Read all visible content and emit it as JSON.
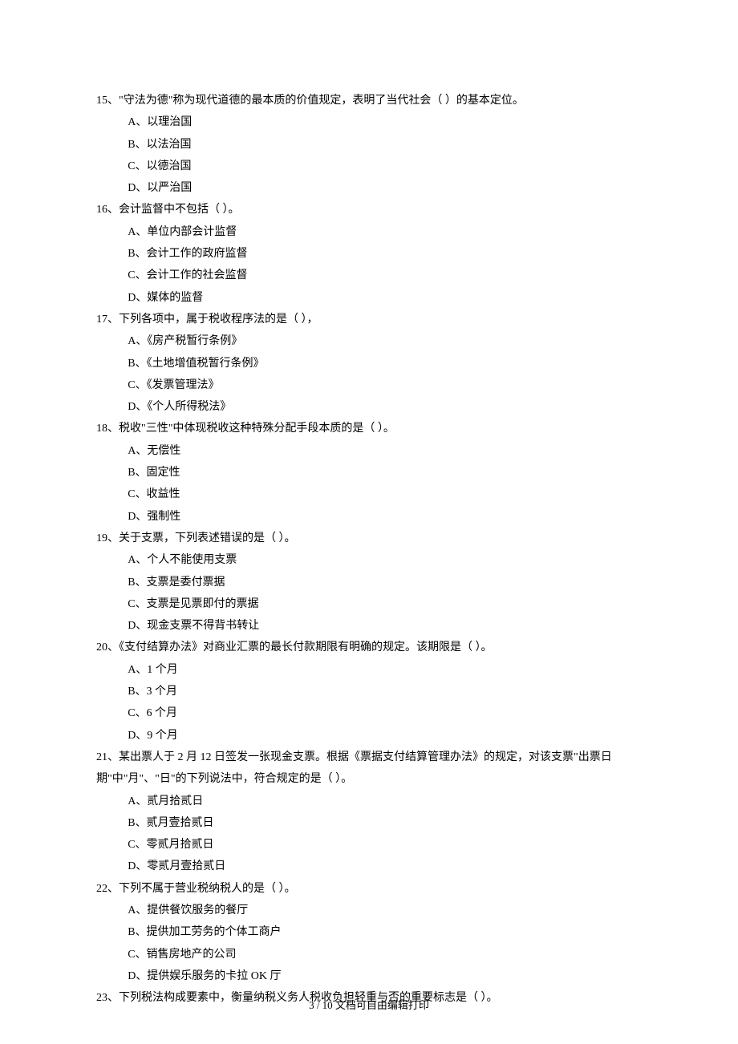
{
  "questions": [
    {
      "num": "15",
      "text": "、\"守法为德\"称为现代道德的最本质的价值规定，表明了当代社会（ ）的基本定位。",
      "options": [
        "A、以理治国",
        "B、以法治国",
        "C、以德治国",
        "D、以严治国"
      ]
    },
    {
      "num": "16",
      "text": "、会计监督中不包括（ ）。",
      "options": [
        "A、单位内部会计监督",
        "B、会计工作的政府监督",
        "C、会计工作的社会监督",
        "D、媒体的监督"
      ]
    },
    {
      "num": "17",
      "text": "、下列各项中，属于税收程序法的是（ ），",
      "options": [
        "A、《房产税暂行条例》",
        "B、《土地增值税暂行条例》",
        "C、《发票管理法》",
        "D、《个人所得税法》"
      ]
    },
    {
      "num": "18",
      "text": "、税收\"三性\"中体现税收这种特殊分配手段本质的是（ ）。",
      "options": [
        "A、无偿性",
        "B、固定性",
        "C、收益性",
        "D、强制性"
      ]
    },
    {
      "num": "19",
      "text": "、关于支票，下列表述错误的是（ ）。",
      "options": [
        "A、个人不能使用支票",
        "B、支票是委付票据",
        "C、支票是见票即付的票据",
        "D、现金支票不得背书转让"
      ]
    },
    {
      "num": "20",
      "text": "、《支付结算办法》对商业汇票的最长付款期限有明确的规定。该期限是（ ）。",
      "options": [
        "A、1 个月",
        "B、3 个月",
        "C、6 个月",
        "D、9 个月"
      ]
    },
    {
      "num": "21",
      "text": "、某出票人于 2 月 12 日签发一张现金支票。根据《票据支付结算管理办法》的规定，对该支票\"出票日期\"中\"月\"、\"日\"的下列说法中，符合规定的是（ ）。",
      "options": [
        "A、贰月拾贰日",
        "B、贰月壹拾贰日",
        "C、零贰月拾贰日",
        "D、零贰月壹拾贰日"
      ]
    },
    {
      "num": "22",
      "text": "、下列不属于营业税纳税人的是（ ）。",
      "options": [
        "A、提供餐饮服务的餐厅",
        "B、提供加工劳务的个体工商户",
        "C、销售房地产的公司",
        "D、提供娱乐服务的卡拉 OK 厅"
      ]
    },
    {
      "num": "23",
      "text": "、下列税法构成要素中，衡量纳税义务人税收负担轻重与否的重要标志是（ ）。",
      "options": []
    }
  ],
  "footer": "3 / 10 文档可自由编辑打印"
}
